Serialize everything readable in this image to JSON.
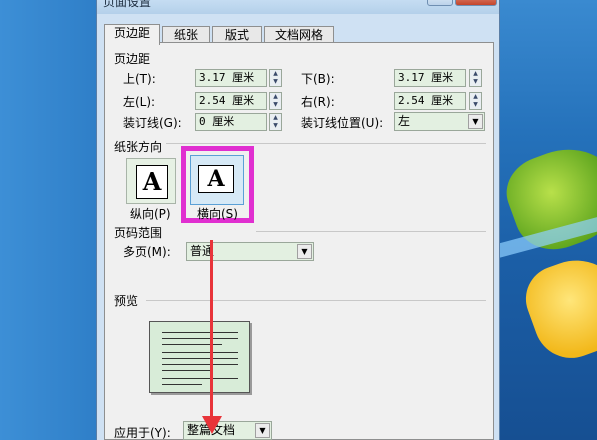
{
  "window": {
    "title": "页面设置",
    "help_button": "?",
    "close_button": "X"
  },
  "tabs": [
    "页边距",
    "纸张",
    "版式",
    "文档网格"
  ],
  "margins": {
    "section_title": "页边距",
    "top_label": "上(T):",
    "top_value": "3.17 厘米",
    "bottom_label": "下(B):",
    "bottom_value": "3.17 厘米",
    "left_label": "左(L):",
    "left_value": "2.54 厘米",
    "right_label": "右(R):",
    "right_value": "2.54 厘米",
    "gutter_label": "装订线(G):",
    "gutter_value": "0 厘米",
    "gutter_position_label": "装订线位置(U):",
    "gutter_position_value": "左"
  },
  "orientation": {
    "section_title": "纸张方向",
    "portrait_label": "纵向(P)",
    "landscape_label": "横向(S)",
    "selected": "landscape",
    "highlight_color": "#e02fd0"
  },
  "pages": {
    "section_title": "页码范围",
    "multiple_label": "多页(M):",
    "multiple_value": "普通"
  },
  "preview": {
    "section_title": "预览"
  },
  "apply": {
    "label": "应用于(Y):",
    "value": "整篇文档"
  },
  "annotation": {
    "arrow_color": "#e8343a"
  }
}
